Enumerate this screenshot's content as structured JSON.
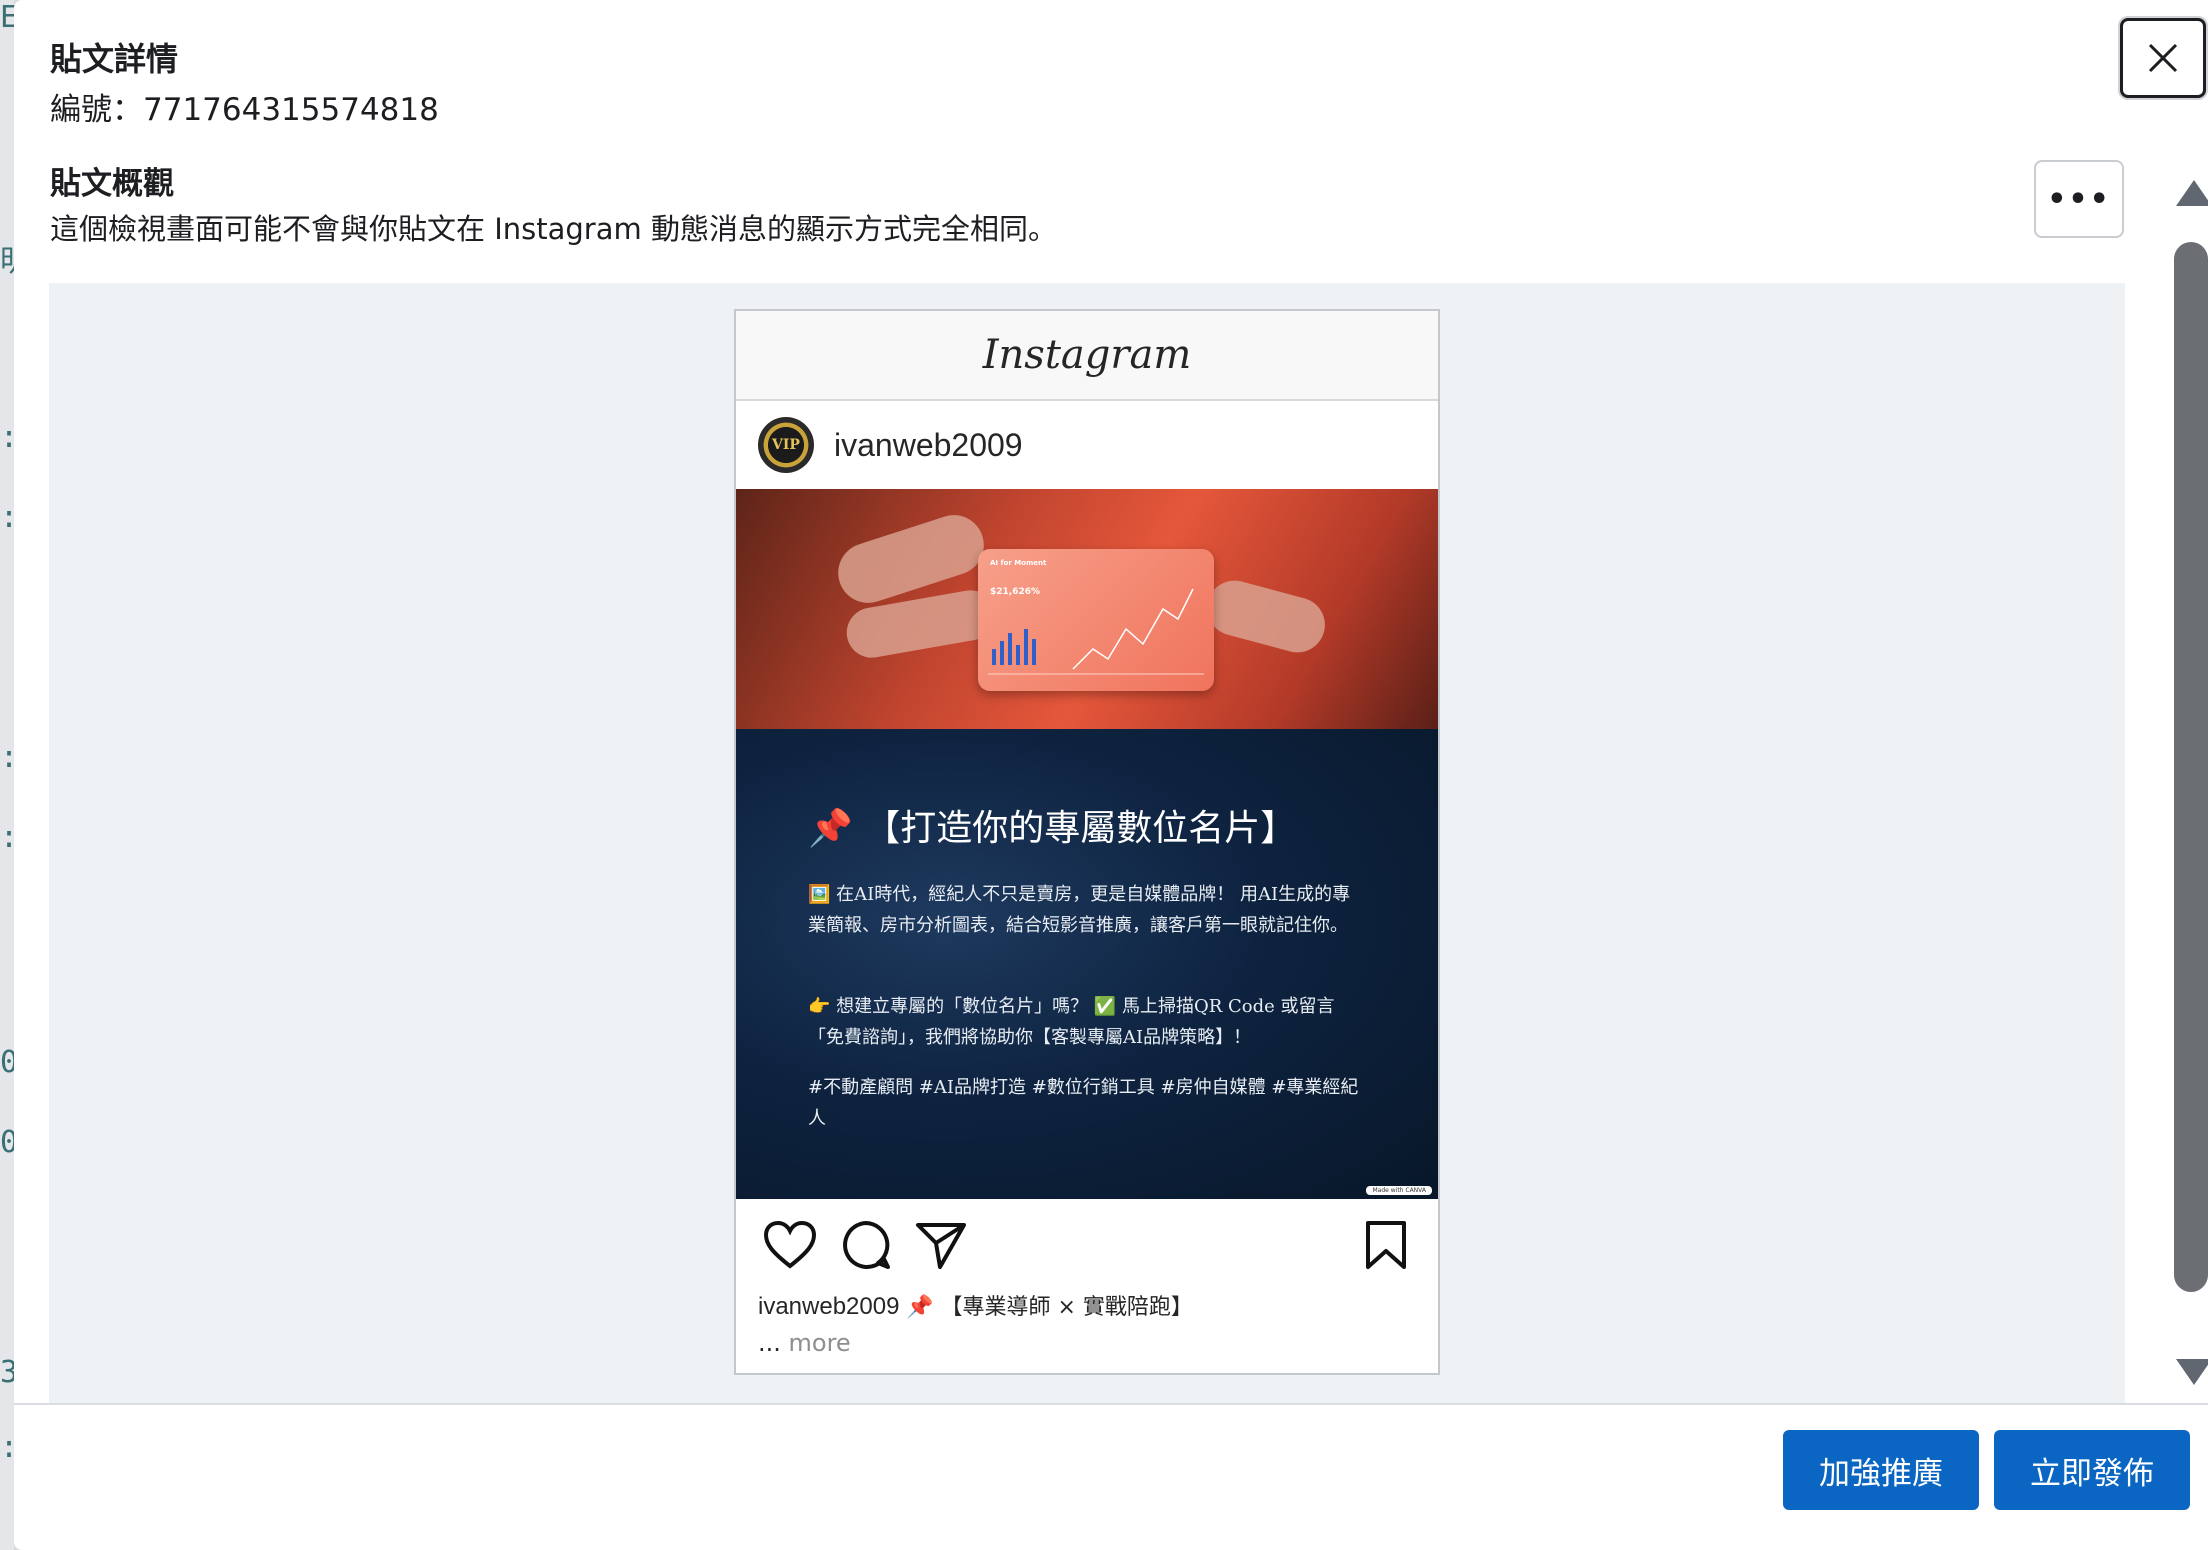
{
  "modal": {
    "title": "貼文詳情",
    "post_id": "編號：771764315574818",
    "close_icon": "close-icon"
  },
  "overview": {
    "title": "貼文概觀",
    "description": "這個檢視畫面可能不會與你貼文在 Instagram 動態消息的顯示方式完全相同。",
    "more_label": "•••"
  },
  "preview": {
    "brand": "Instagram",
    "username": "ivanweb2009",
    "avatar_text": "VIP",
    "image": {
      "dashboard_title": "AI for Moment",
      "dashboard_value": "$21,626%",
      "headline": "📌 【打造你的專屬數位名片】",
      "paragraph1": "🖼️ 在AI時代，經紀人不只是賣房，更是自媒體品牌！ 用AI生成的專業簡報、房市分析圖表，結合短影音推廣，讓客戶第一眼就記住你。",
      "paragraph2": "👉 想建立專屬的「數位名片」嗎？ ✅ 馬上掃描QR Code 或留言「免費諮詢」，我們將協助你【客製專屬AI品牌策略】！",
      "hashtags": "#不動產顧問 #AI品牌打造 #數位行銷工具 #房仲自媒體 #專業經紀人",
      "watermark": "Made with CANVA"
    },
    "caption_user": "ivanweb2009",
    "caption_text": "📌 【專業導師 × 實戰陪跑】",
    "caption_more_prefix": "... ",
    "caption_more": "more"
  },
  "footer": {
    "boost_label": "加強推廣",
    "publish_label": "立即發佈"
  },
  "colors": {
    "primary": "#0a66c2",
    "preview_bg": "#eff2f5"
  }
}
